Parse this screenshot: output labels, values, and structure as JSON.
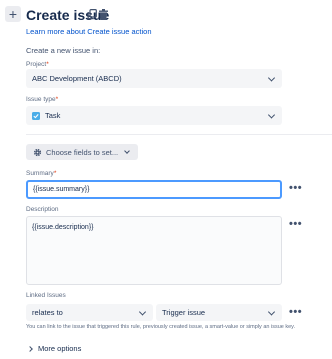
{
  "header": {
    "plus_glyph": "+",
    "title": "Create issue",
    "learn_link": "Learn more about Create issue action",
    "intro": "Create a new issue in:"
  },
  "project": {
    "label": "Project",
    "required_mark": "*",
    "value": "ABC Development (ABCD)"
  },
  "issue_type": {
    "label": "Issue type",
    "required_mark": "*",
    "value": "Task"
  },
  "choose_fields": {
    "label": "Choose fields to set..."
  },
  "summary": {
    "label": "Summary",
    "required_mark": "*",
    "value": "{{issue.summary}}"
  },
  "description": {
    "label": "Description",
    "value": "{{issue.description}}"
  },
  "linked_issues": {
    "label": "Linked Issues",
    "relation": "relates to",
    "target": "Trigger issue",
    "help": "You can link to the issue that triggered this rule, previously created issue, a smart-value or simply an issue key."
  },
  "more_glyph": "•••",
  "more_options": {
    "label": "More options"
  },
  "colors": {
    "accent": "#0052cc",
    "focus_border": "#4c9aff",
    "required": "#de350b",
    "task_icon": "#4bade8"
  }
}
